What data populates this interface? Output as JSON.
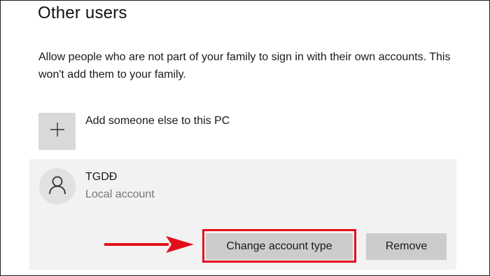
{
  "section": {
    "title": "Other users",
    "description": "Allow people who are not part of your family to sign in with their own accounts. This won't add them to your family."
  },
  "add_user": {
    "label": "Add someone else to this PC",
    "icon": "plus-icon"
  },
  "account": {
    "name": "TGDĐ",
    "type": "Local account",
    "avatar_icon": "user-icon"
  },
  "actions": {
    "change_label": "Change account type",
    "remove_label": "Remove"
  },
  "annotation": {
    "arrow_icon": "right-arrow-icon",
    "highlight_color": "#e3101c"
  },
  "colors": {
    "add_tile": "#d9d9d9",
    "panel": "#f2f2f2",
    "button": "#cccccc",
    "secondary_text": "#777777"
  }
}
